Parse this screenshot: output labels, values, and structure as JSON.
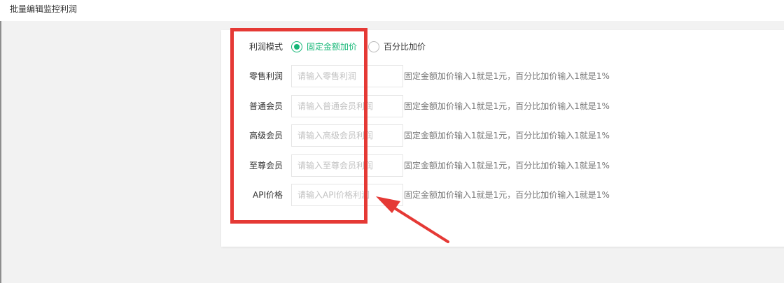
{
  "window": {
    "title": "批量编辑监控利润"
  },
  "form": {
    "mode": {
      "label": "利润模式",
      "options": [
        {
          "label": "固定金额加价",
          "checked": true
        },
        {
          "label": "百分比加价",
          "checked": false
        }
      ]
    },
    "rows": [
      {
        "label": "零售利润",
        "placeholder": "请输入零售利润",
        "hint": "固定金额加价输入1就是1元，百分比加价输入1就是1%"
      },
      {
        "label": "普通会员",
        "placeholder": "请输入普通会员利润",
        "hint": "固定金额加价输入1就是1元，百分比加价输入1就是1%"
      },
      {
        "label": "高级会员",
        "placeholder": "请输入高级会员利润",
        "hint": "固定金额加价输入1就是1元，百分比加价输入1就是1%"
      },
      {
        "label": "至尊会员",
        "placeholder": "请输入至尊会员利润",
        "hint": "固定金额加价输入1就是1元，百分比加价输入1就是1%"
      },
      {
        "label": "API价格",
        "placeholder": "请输入API价格利润",
        "hint": "固定金额加价输入1就是1元，百分比加价输入1就是1%"
      }
    ]
  },
  "colors": {
    "accent": "#16b777",
    "annotation": "#e53935"
  }
}
